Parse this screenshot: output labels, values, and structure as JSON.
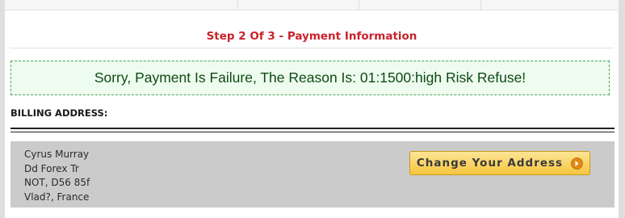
{
  "checkout": {
    "step_title": "Step 2 Of 3 - Payment Information",
    "error_message": "Sorry, Payment Is Failure, The Reason Is: 01:1500:high Risk Refuse!",
    "billing_label": "BILLING ADDRESS:",
    "address": {
      "name": "Cyrus Murray",
      "street": "Dd Forex Tr",
      "region": "NOT, D56 85f",
      "city_country": "Vlad?, France"
    },
    "change_address_label": "Change Your Address"
  },
  "colors": {
    "step_title": "#c8232c",
    "error_text": "#0e4a13",
    "error_border": "#49a55a",
    "error_background": "#eefcf0",
    "button_gold": "#f6c53d",
    "address_background": "#cbcbcb"
  },
  "icons": {
    "button_arrow": "arrow-right-circle-icon"
  }
}
